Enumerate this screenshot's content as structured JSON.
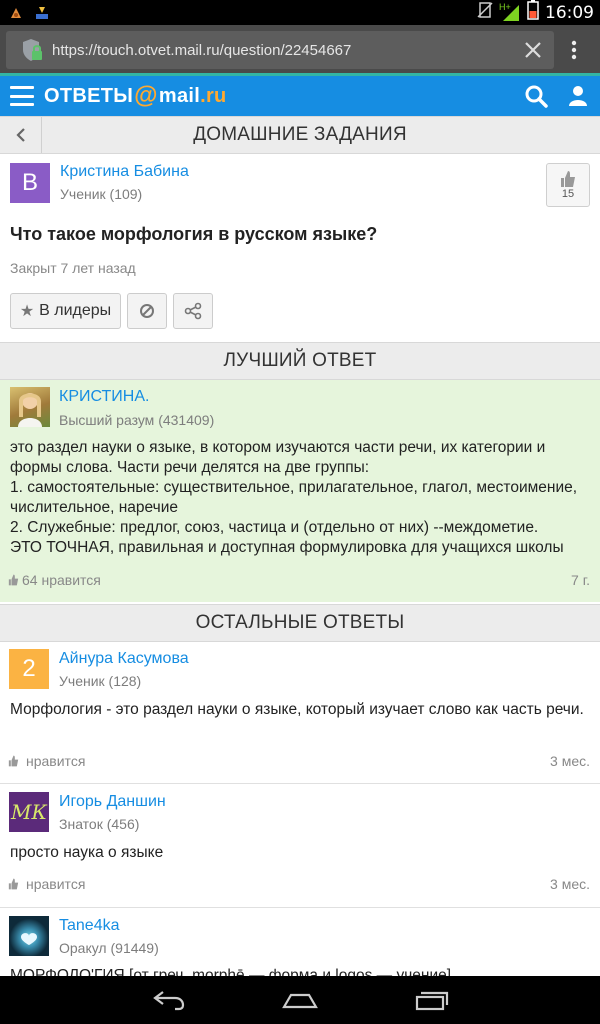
{
  "status_bar": {
    "time": "16:09",
    "network": "H+"
  },
  "browser": {
    "url": "https://touch.otvet.mail.ru/question/22454667"
  },
  "site": {
    "logo_main": "ОТВЕТЫ",
    "logo_at": "@",
    "logo_mail": "mail",
    "logo_dot": ".",
    "logo_ru": "ru"
  },
  "question_section": {
    "title": "ДОМАШНИЕ ЗАДАНИЯ"
  },
  "question": {
    "author": "Кристина Бабина",
    "author_rank": "Ученик (109)",
    "avatar_letter": "B",
    "like_count": "15",
    "text": "Что такое морфология в русском языке?",
    "closed": "Закрыт 7 лет назад",
    "leaders_button": "В лидеры"
  },
  "best_answer": {
    "section_title": "ЛУЧШИЙ ОТВЕТ",
    "author": "КРИСТИНА.",
    "author_rank": "Высший разум (431409)",
    "text": "это раздел науки о языке, в котором изучаются части речи, их категории и формы слова. Части речи делятся на две группы:\n1. самостоятельные: существительное, прилагательное, глагол, местоимение, числительное, наречие\n2. Служебные: предлог, союз, частица и (отдельно от них) --междометие.\nЭТО ТОЧНАЯ, правильная и доступная формулировка для учащихся школы",
    "likes": "64 нравится",
    "age": "7 г."
  },
  "other_answers": {
    "section_title": "ОСТАЛЬНЫЕ ОТВЕТЫ",
    "items": [
      {
        "author": "Айнура Касумова",
        "rank": "Ученик (128)",
        "avatar_letter": "2",
        "text": "Морфология - это раздел науки о языке, который изучает слово как часть речи.",
        "likes": "нравится",
        "age": "3 мес."
      },
      {
        "author": "Игорь Даншин",
        "rank": "Знаток (456)",
        "avatar_letter": "МК",
        "text": "просто наука о языке",
        "likes": "нравится",
        "age": "3 мес."
      },
      {
        "author": "Tane4ka",
        "rank": "Оракул (91449)",
        "text": "МОРФОЛО'ГИЯ [от греч. morphē — форма и logos — учение]"
      }
    ]
  },
  "colors": {
    "accent": "#168de2",
    "best_bg": "#e6f5dc",
    "logo_orange": "#ffa930"
  }
}
